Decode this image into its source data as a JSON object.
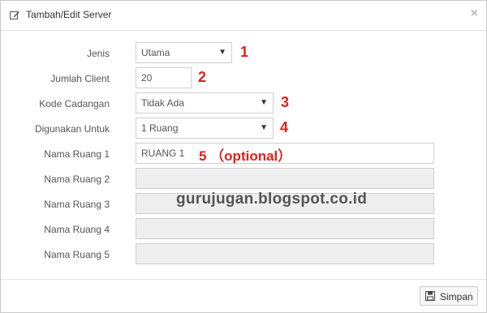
{
  "dialog": {
    "title": "Tambah/Edit Server",
    "close_label": "×",
    "save_label": "Simpan"
  },
  "form": {
    "jenis": {
      "label": "Jenis",
      "value": "Utama",
      "marker": "1"
    },
    "jumlah_client": {
      "label": "Jumlah Client",
      "value": "20",
      "marker": "2"
    },
    "kode_cadangan": {
      "label": "Kode Cadangan",
      "value": "Tidak Ada",
      "marker": "3"
    },
    "digunakan_untuk": {
      "label": "Digunakan Untuk",
      "value": "1 Ruang",
      "marker": "4"
    },
    "ruang": [
      {
        "label": "Nama Ruang 1",
        "value": "RUANG 1"
      },
      {
        "label": "Nama Ruang 2",
        "value": ""
      },
      {
        "label": "Nama Ruang 3",
        "value": ""
      },
      {
        "label": "Nama Ruang 4",
        "value": ""
      },
      {
        "label": "Nama Ruang 5",
        "value": ""
      }
    ],
    "ruang1_annotation": "5 （optional）"
  },
  "watermark": "gurujugan.blogspot.co.id",
  "colors": {
    "annotation": "#e0201b",
    "disabled_bg": "#eeeeee"
  },
  "icons": {
    "title": "edit-icon",
    "save": "save-icon",
    "select": "caret-down-icon"
  }
}
